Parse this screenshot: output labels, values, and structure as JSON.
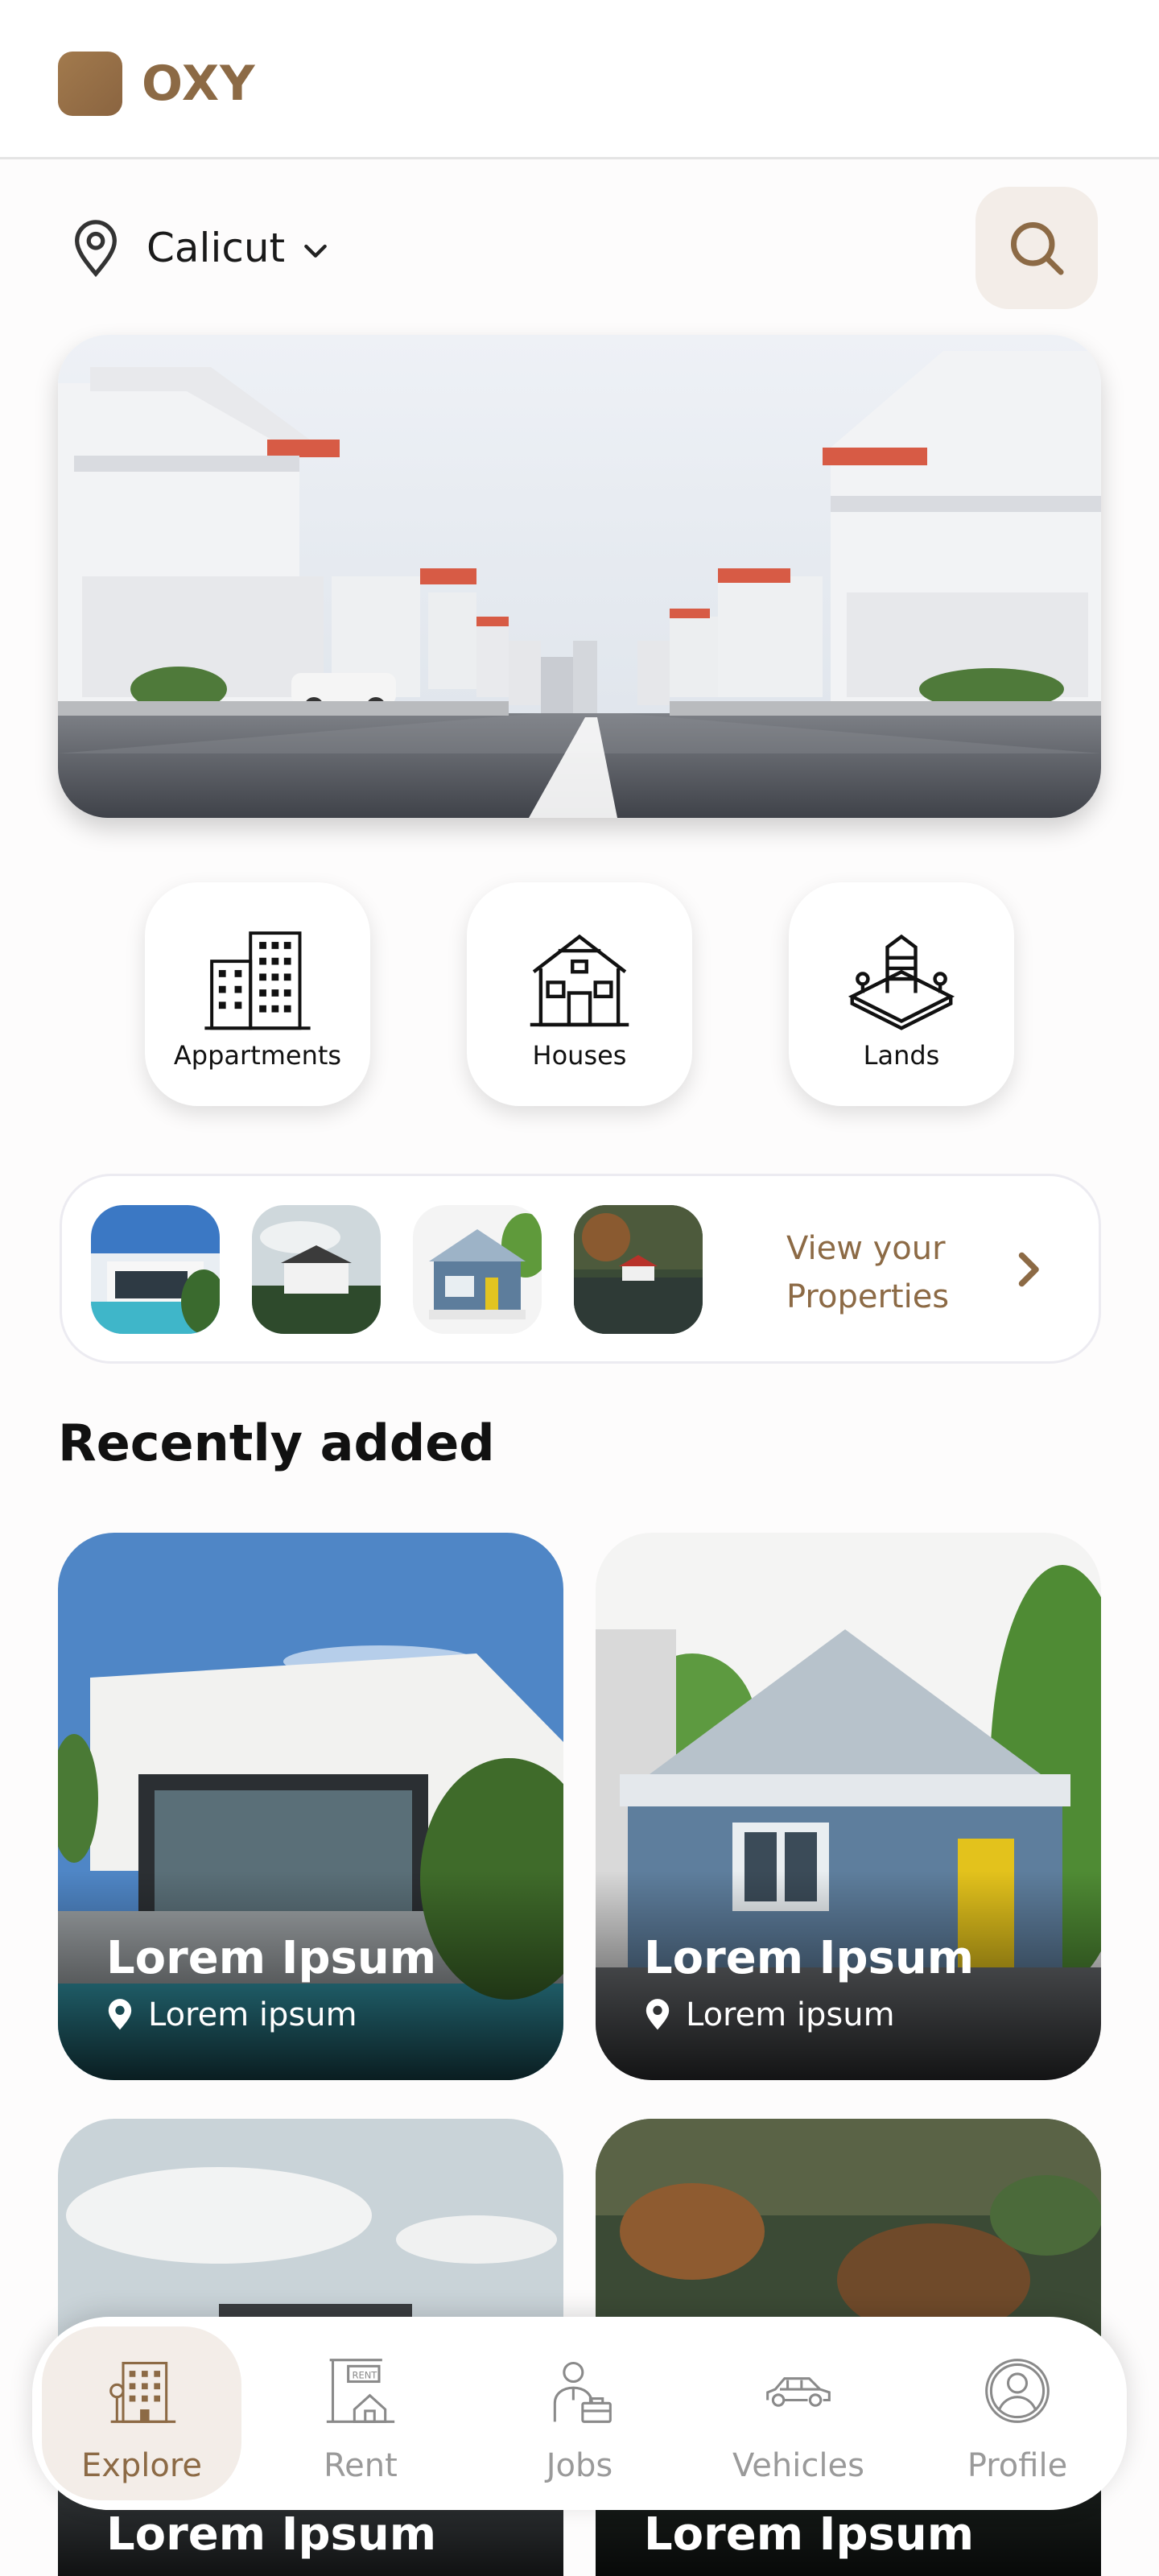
{
  "app": {
    "logo_text": "OXY"
  },
  "location": {
    "city": "Calicut"
  },
  "icons": {
    "location": "map-pin-icon",
    "dropdown": "chevron-down-icon",
    "search": "search-icon",
    "forward": "chevron-right-icon"
  },
  "categories": [
    {
      "label": "Appartments",
      "icon": "apartment-building-icon"
    },
    {
      "label": "Houses",
      "icon": "house-icon"
    },
    {
      "label": "Lands",
      "icon": "land-plot-icon"
    }
  ],
  "properties_strip": {
    "cta_label": "View your Properties"
  },
  "recent": {
    "title": "Recently added",
    "cards": [
      {
        "title": "Lorem Ipsum",
        "location": "Lorem ipsum"
      },
      {
        "title": "Lorem Ipsum",
        "location": "Lorem ipsum"
      },
      {
        "title": "Lorem Ipsum"
      },
      {
        "title": "Lorem Ipsum"
      }
    ]
  },
  "nav": {
    "items": [
      {
        "label": "Explore",
        "icon": "buildings-icon",
        "active": true
      },
      {
        "label": "Rent",
        "icon": "rent-sign-icon",
        "active": false
      },
      {
        "label": "Jobs",
        "icon": "job-person-icon",
        "active": false
      },
      {
        "label": "Vehicles",
        "icon": "car-icon",
        "active": false
      },
      {
        "label": "Profile",
        "icon": "user-circle-icon",
        "active": false
      }
    ]
  },
  "colors": {
    "brand": "#8c6a45",
    "brand_light": "#f3ede8",
    "text": "#111111",
    "muted": "#9a9a9a"
  }
}
